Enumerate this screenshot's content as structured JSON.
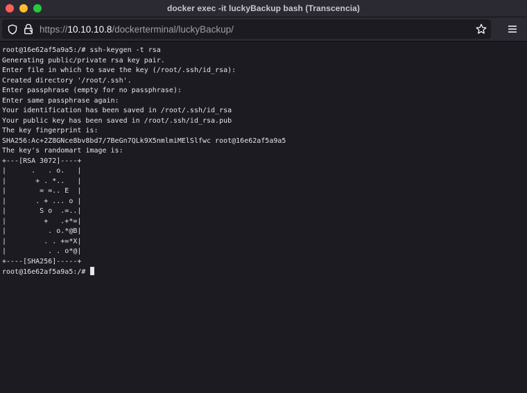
{
  "window": {
    "title": "docker exec -it luckyBackup bash (Transcencia)"
  },
  "toolbar": {
    "url_scheme": "https://",
    "url_host": "10.10.10.8",
    "url_path": "/dockerterminal/luckyBackup/"
  },
  "terminal": {
    "lines": [
      "root@16e62af5a9a5:/# ssh-keygen -t rsa",
      "Generating public/private rsa key pair.",
      "Enter file in which to save the key (/root/.ssh/id_rsa):",
      "Created directory '/root/.ssh'.",
      "Enter passphrase (empty for no passphrase):",
      "Enter same passphrase again:",
      "Your identification has been saved in /root/.ssh/id_rsa",
      "Your public key has been saved in /root/.ssh/id_rsa.pub",
      "The key fingerprint is:",
      "SHA256:Ac+2Z8GNce8bv8bd7/7BeGn7QLk9X5nmlmiMElSlfwc root@16e62af5a9a5",
      "The key's randomart image is:",
      "+---[RSA 3072]----+",
      "|      .   . o.   |",
      "|       + . *..   |",
      "|        = =.. E  |",
      "|       . + ... o |",
      "|        S o  .=..|",
      "|         +   .+*=|",
      "|          . o.*@B|",
      "|         . . +=*X|",
      "|          . . o*@|",
      "+----[SHA256]-----+"
    ],
    "prompt": "root@16e62af5a9a5:/# "
  },
  "colors": {
    "terminal_bg": "#1c1b22",
    "terminal_fg": "#e6e6e6",
    "chrome_bg": "#2b2a33"
  },
  "icons": [
    "shield-icon",
    "lock-icon",
    "bookmark-star-icon",
    "hamburger-menu-icon"
  ]
}
